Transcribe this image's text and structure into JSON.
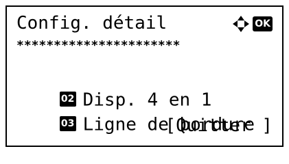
{
  "header": {
    "title": "Config. détail",
    "ok_label": "OK",
    "separator": "**********************"
  },
  "menu": {
    "items": [
      {
        "number": "02",
        "label": "Disp. 4 en 1"
      },
      {
        "number": "03",
        "label": "Ligne de bordure"
      }
    ]
  },
  "softkey": {
    "right_label": "[Quitter ]"
  },
  "icons": {
    "nav": "four-way-arrows-icon",
    "ok": "ok-key-icon"
  }
}
